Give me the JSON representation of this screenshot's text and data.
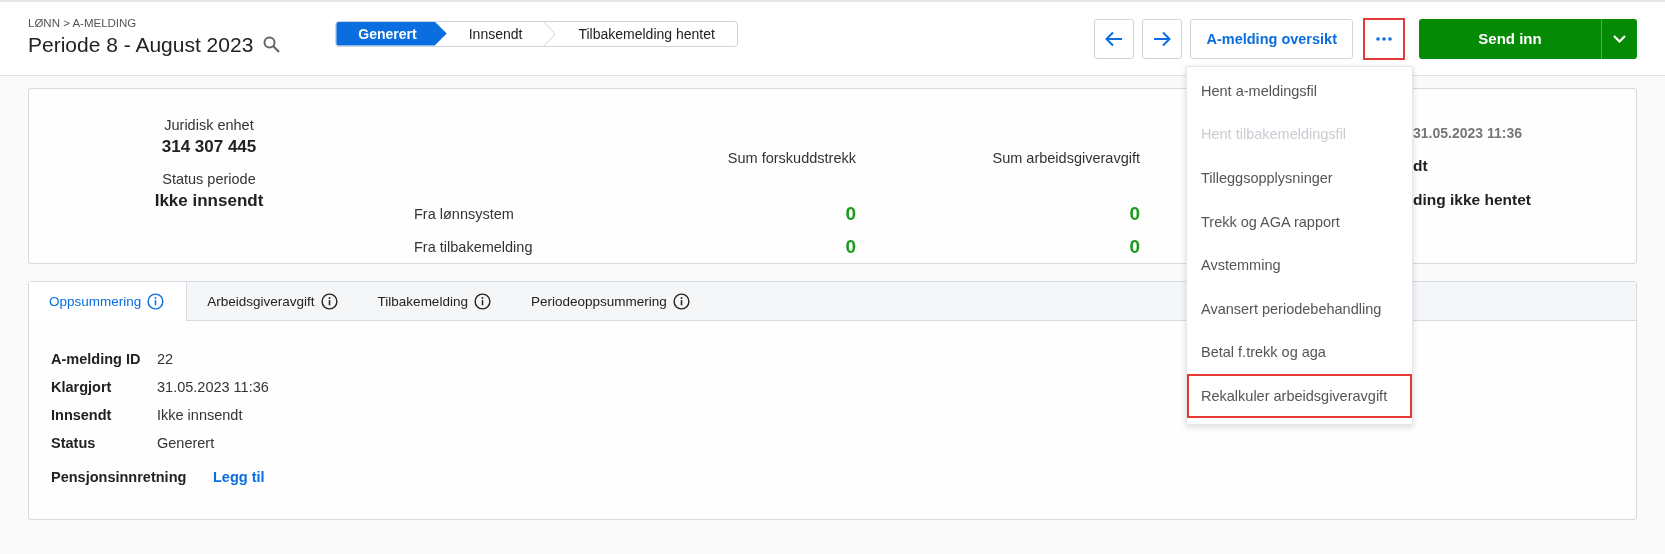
{
  "breadcrumb": "LØNN > A-MELDING",
  "title": "Periode 8 - August 2023",
  "steps": [
    {
      "label": "Generert",
      "selected": true
    },
    {
      "label": "Innsendt",
      "selected": false
    },
    {
      "label": "Tilbakemelding hentet",
      "selected": false
    }
  ],
  "toolbar": {
    "overview_button": "A-melding oversikt",
    "more_button": {
      "highlighted": true
    },
    "primary_button": "Send inn"
  },
  "menu": [
    {
      "label": "Hent a-meldingsfil",
      "disabled": false,
      "highlighted": false
    },
    {
      "label": "Hent tilbakemeldingsfil",
      "disabled": true,
      "highlighted": false
    },
    {
      "label": "Tilleggsopplysninger",
      "disabled": false,
      "highlighted": false
    },
    {
      "label": "Trekk og AGA rapport",
      "disabled": false,
      "highlighted": false
    },
    {
      "label": "Avstemming",
      "disabled": false,
      "highlighted": false
    },
    {
      "label": "Avansert periodebehandling",
      "disabled": false,
      "highlighted": false
    },
    {
      "label": "Betal f.trekk og aga",
      "disabled": false,
      "highlighted": false
    },
    {
      "label": "Rekalkuler arbeidsgiveravgift",
      "disabled": false,
      "highlighted": true
    }
  ],
  "summary": {
    "facts": [
      {
        "label": "Juridisk enhet",
        "value": "314 307 445"
      },
      {
        "label": "Status periode",
        "value": "Ikke innsendt"
      }
    ],
    "columns": [
      "Sum forskuddstrekk",
      "Sum arbeidsgiveravgift"
    ],
    "rows": [
      {
        "label": "Fra lønnsystem",
        "values": [
          "0",
          "0"
        ]
      },
      {
        "label": "Fra tilbakemelding",
        "values": [
          "0",
          "0"
        ]
      }
    ],
    "partly_covered": [
      {
        "text": "31.05.2023 11:36",
        "kind": "muted"
      },
      {
        "text": "dt",
        "kind": "strong"
      },
      {
        "text": "ding ikke hentet",
        "kind": "strong"
      }
    ]
  },
  "tabs": [
    {
      "label": "Oppsummering",
      "selected": true
    },
    {
      "label": "Arbeidsgiveravgift",
      "selected": false
    },
    {
      "label": "Tilbakemelding",
      "selected": false
    },
    {
      "label": "Periodeoppsummering",
      "selected": false
    }
  ],
  "details": [
    {
      "label": "A-melding ID",
      "value": "22"
    },
    {
      "label": "Klargjort",
      "value": "31.05.2023 11:36"
    },
    {
      "label": "Innsendt",
      "value": "Ikke innsendt"
    },
    {
      "label": "Status",
      "value": "Generert"
    }
  ],
  "pension": {
    "label": "Pensjonsinnretning",
    "link": "Legg til"
  }
}
